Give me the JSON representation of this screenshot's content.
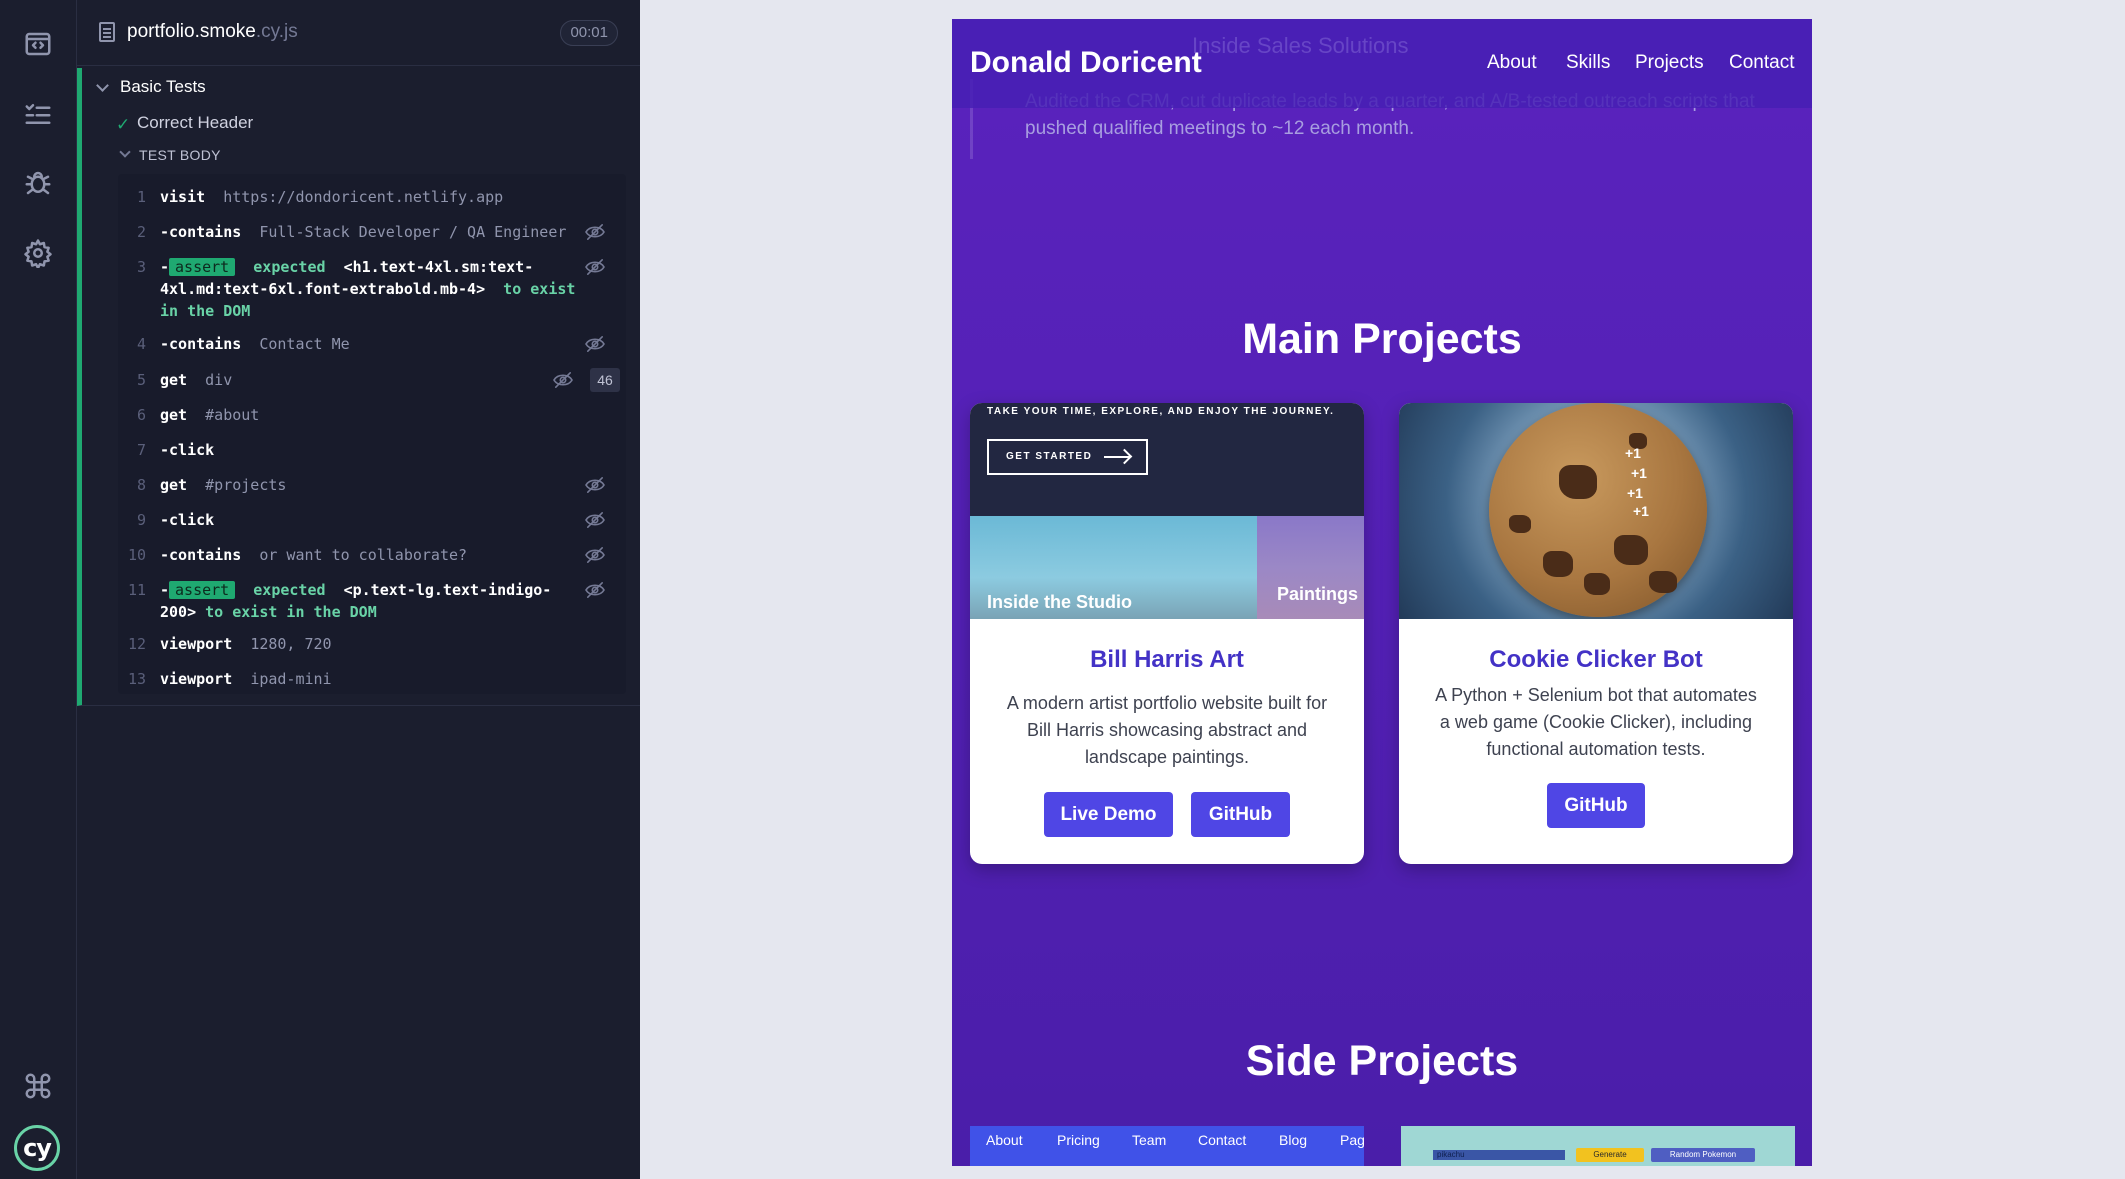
{
  "rail": {
    "icons": [
      "specs-icon",
      "runs-icon",
      "debug-icon",
      "settings-icon",
      "keyboard-shortcuts-icon",
      "cypress-logo"
    ]
  },
  "reporter": {
    "spec_name": "portfolio.smoke",
    "spec_ext": ".cy.js",
    "duration": "00:01",
    "suite_title": "Basic Tests",
    "test_title": "Correct Header",
    "body_label": "TEST BODY",
    "commands": [
      {
        "num": "1",
        "name": "visit",
        "arg": "https://dondoricent.netlify.app"
      },
      {
        "num": "2",
        "name": "-contains",
        "arg": "Full-Stack Developer / QA Engineer"
      },
      {
        "num": "3",
        "prefix": "-",
        "badge": "assert",
        "text1": "expected",
        "text2": "<h1.text-4xl.sm:text-4xl.md:text-6xl.font-extrabold.mb-4>",
        "text3": "to exist in the DOM"
      },
      {
        "num": "4",
        "name": "-contains",
        "arg": "Contact Me"
      },
      {
        "num": "5",
        "name": "get",
        "arg": "div",
        "count": "46"
      },
      {
        "num": "6",
        "name": "get",
        "arg": "#about"
      },
      {
        "num": "7",
        "name": "-click",
        "arg": ""
      },
      {
        "num": "8",
        "name": "get",
        "arg": "#projects"
      },
      {
        "num": "9",
        "name": "-click",
        "arg": ""
      },
      {
        "num": "10",
        "name": "-contains",
        "arg": "or want to collaborate?"
      },
      {
        "num": "11",
        "prefix": "-",
        "badge": "assert",
        "text1": "expected",
        "text2": "<p.text-lg.text-indigo-200>",
        "text3": "to exist in the DOM"
      },
      {
        "num": "12",
        "name": "viewport",
        "arg": "1280, 720"
      },
      {
        "num": "13",
        "name": "viewport",
        "arg": "ipad-mini"
      }
    ]
  },
  "app": {
    "ghost_heading": "Inside Sales Solutions",
    "brand": "Donald Doricent",
    "nav": [
      "About",
      "Skills",
      "Projects",
      "Contact"
    ],
    "about_text": "Audited the CRM, cut duplicate leads by a quarter, and A/B-tested outreach scripts that pushed qualified meetings to ~12 each month.",
    "main_projects_title": "Main Projects",
    "side_projects_title": "Side Projects",
    "cards": [
      {
        "title": "Bill Harris Art",
        "description": "A modern artist portfolio website built for Bill Harris showcasing abstract and landscape paintings.",
        "buttons": [
          "Live Demo",
          "GitHub"
        ],
        "image": {
          "tagline": "TAKE YOUR TIME, EXPLORE, AND ENJOY THE JOURNEY.",
          "cta": "GET STARTED",
          "studio_label": "Inside the Studio",
          "paintings_label": "Paintings"
        }
      },
      {
        "title": "Cookie Clicker Bot",
        "description": "A Python + Selenium bot that automates a web game (Cookie Clicker), including functional automation tests.",
        "buttons": [
          "GitHub"
        ],
        "image": {
          "plus_label": "+1"
        }
      }
    ],
    "side_left_nav": [
      "About",
      "Pricing",
      "Team",
      "Contact",
      "Blog",
      "Pag"
    ],
    "side_right": {
      "input_value": "pikachu",
      "generate": "Generate",
      "random": "Random Pokemon"
    }
  },
  "colors": {
    "pass_green": "#1fa971",
    "reporter_bg": "#1b1e2e",
    "app_purple": "#5a23bd",
    "card_title": "#4332c6",
    "button_indigo": "#4f46e5"
  }
}
